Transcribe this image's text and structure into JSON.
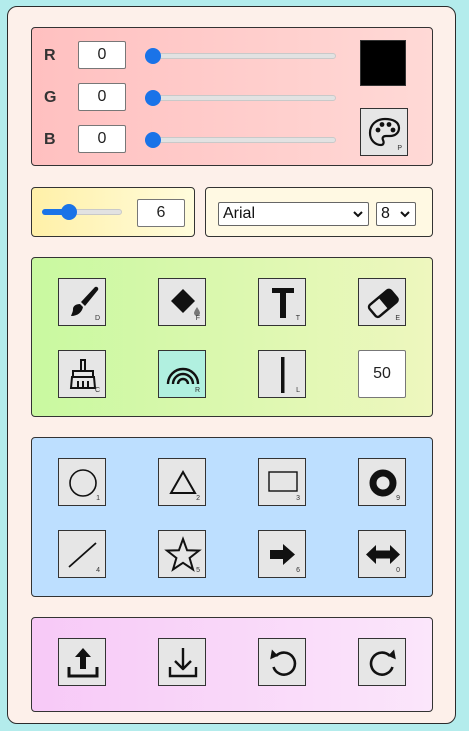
{
  "color": {
    "red_label": "R",
    "red_value": "0",
    "red_level": 0,
    "green_label": "G",
    "green_value": "0",
    "green_level": 0,
    "blue_label": "B",
    "blue_value": "0",
    "blue_level": 0,
    "current_color": "#000000",
    "palette_key": "P"
  },
  "brush": {
    "size_value": "6",
    "size_level": 0.06
  },
  "font": {
    "family": "Arial",
    "size": "8"
  },
  "tools": {
    "brush_key": "D",
    "fill_key": "F",
    "text_key": "T",
    "eraser_key": "E",
    "clear_key": "C",
    "rainbow_key": "R",
    "line_width_key": "L",
    "opacity_value": "50",
    "active_tool": "rainbow"
  },
  "shapes": {
    "circle_key": "1",
    "triangle_key": "2",
    "rectangle_key": "3",
    "ring_key": "9",
    "line_key": "4",
    "star_key": "5",
    "arrow_key": "6",
    "double_arrow_key": "0"
  },
  "colors": {
    "accent": "#1a73e8"
  }
}
